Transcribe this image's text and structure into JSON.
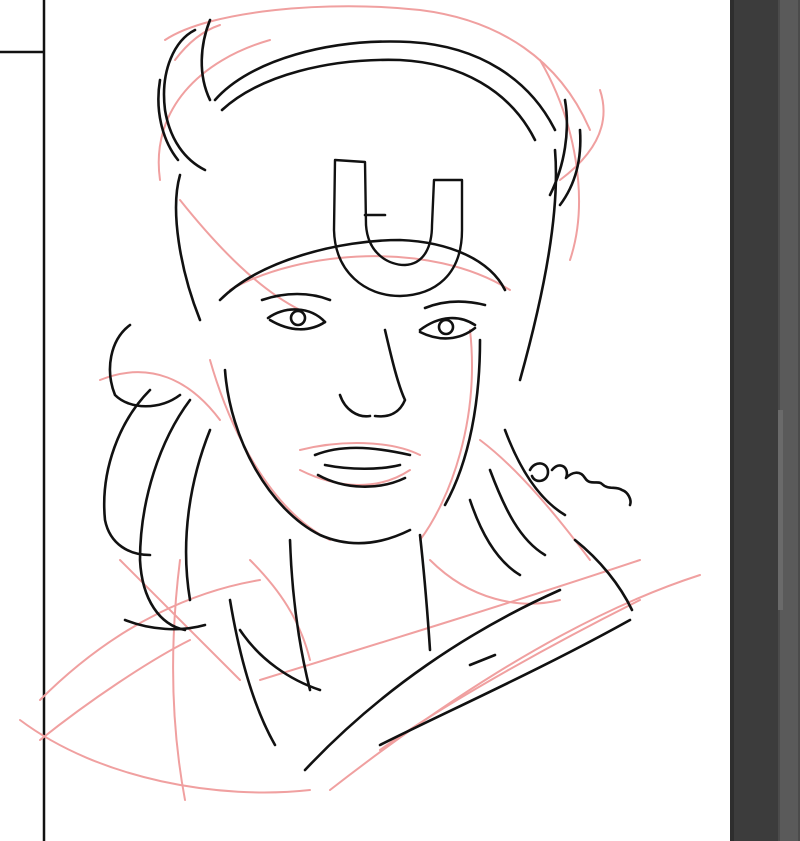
{
  "app": {
    "background_color": "#ffffff",
    "panel_color": "#3c3c3c"
  },
  "artwork": {
    "signature_text": "Ogawa",
    "sketch_color": "#f08c8c",
    "ink_color": "#111111",
    "icons": [
      "frame-border",
      "portrait-sketch"
    ]
  }
}
